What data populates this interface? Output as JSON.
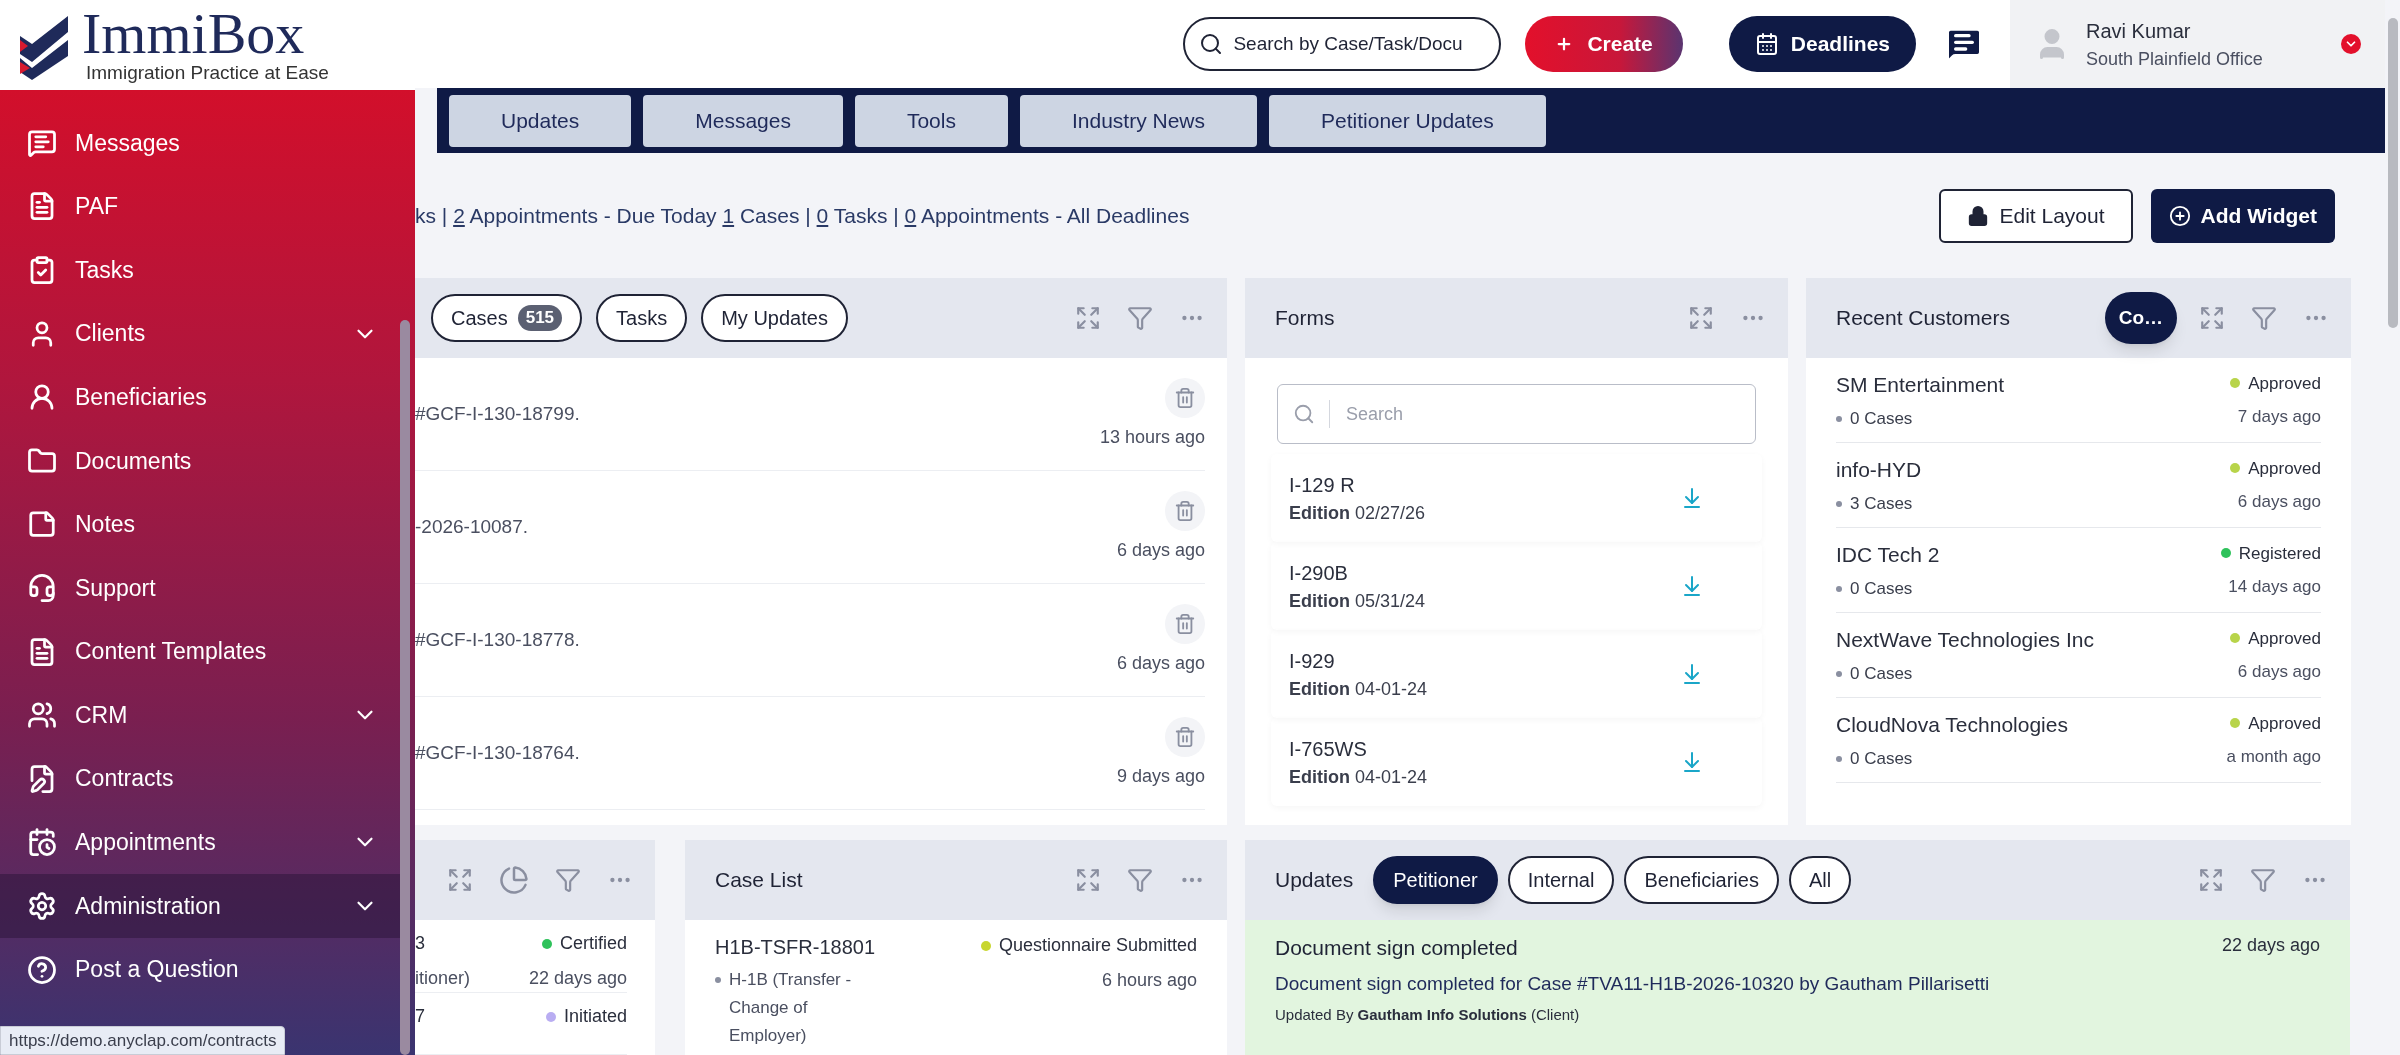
{
  "logo": {
    "name": "ImmiBox",
    "tagline": "Immigration Practice at Ease"
  },
  "sidebar": {
    "items": [
      {
        "label": "Messages",
        "expandable": false,
        "selected": false
      },
      {
        "label": "PAF",
        "expandable": false,
        "selected": false
      },
      {
        "label": "Tasks",
        "expandable": false,
        "selected": false
      },
      {
        "label": "Clients",
        "expandable": true,
        "selected": false
      },
      {
        "label": "Beneficiaries",
        "expandable": false,
        "selected": false
      },
      {
        "label": "Documents",
        "expandable": false,
        "selected": false
      },
      {
        "label": "Notes",
        "expandable": false,
        "selected": false
      },
      {
        "label": "Support",
        "expandable": false,
        "selected": false
      },
      {
        "label": "Content Templates",
        "expandable": false,
        "selected": false
      },
      {
        "label": "CRM",
        "expandable": true,
        "selected": false
      },
      {
        "label": "Contracts",
        "expandable": false,
        "selected": false
      },
      {
        "label": "Appointments",
        "expandable": true,
        "selected": false
      },
      {
        "label": "Administration",
        "expandable": true,
        "selected": true
      },
      {
        "label": "Post a Question",
        "expandable": false,
        "selected": false
      }
    ]
  },
  "status_url": "https://demo.anyclap.com/contracts",
  "header": {
    "search": {
      "placeholder": "Search by Case/Task/Docu"
    },
    "create": "Create",
    "deadlines": "Deadlines",
    "user": {
      "name": "Ravi Kumar",
      "office": "South Plainfield Office"
    }
  },
  "nav_tabs": [
    {
      "label": "Updates",
      "selected": false
    },
    {
      "label": "Messages",
      "selected": false
    },
    {
      "label": "Tools",
      "selected": false
    },
    {
      "label": "Industry News",
      "selected": false
    },
    {
      "label": "Petitioner Updates",
      "selected": false
    }
  ],
  "deadline_summary": [
    {
      "text": "ks | ",
      "link": false
    },
    {
      "text": "2",
      "link": true
    },
    {
      "text": " Appointments - Due Today ",
      "link": false
    },
    {
      "text": "1",
      "link": true
    },
    {
      "text": " Cases | ",
      "link": false
    },
    {
      "text": "0",
      "link": true
    },
    {
      "text": " Tasks | ",
      "link": false
    },
    {
      "text": "0",
      "link": true
    },
    {
      "text": " Appointments - All Deadlines",
      "link": false
    }
  ],
  "buttons": {
    "edit_layout": "Edit Layout",
    "add_widget": "Add Widget"
  },
  "activity_widget": {
    "filters": [
      {
        "label": "Cases",
        "count": "515",
        "selected": false
      },
      {
        "label": "Tasks",
        "selected": false
      },
      {
        "label": "My Updates",
        "selected": false
      }
    ],
    "rows": [
      {
        "text": "#GCF-I-130-18799.",
        "time": "13 hours ago"
      },
      {
        "text": "-2026-10087.",
        "time": "6 days ago"
      },
      {
        "text": "#GCF-I-130-18778.",
        "time": "6 days ago"
      },
      {
        "text": "#GCF-I-130-18764.",
        "time": "9 days ago"
      }
    ]
  },
  "forms_widget": {
    "title": "Forms",
    "search": {
      "placeholder": "Search"
    },
    "forms": [
      {
        "name": "I-129 R",
        "edition_label": "Edition",
        "edition": "02/27/26"
      },
      {
        "name": "I-290B",
        "edition_label": "Edition",
        "edition": "05/31/24"
      },
      {
        "name": "I-929",
        "edition_label": "Edition",
        "edition": "04-01-24"
      },
      {
        "name": "I-765WS",
        "edition_label": "Edition",
        "edition": "04-01-24"
      }
    ]
  },
  "recent_customers": {
    "title": "Recent Customers",
    "toggle": "Co…",
    "customers": [
      {
        "name": "SM Entertainment",
        "cases": "0 Cases",
        "status": "Approved",
        "color": "#b8d44a",
        "time": "7 days ago"
      },
      {
        "name": "info-HYD",
        "cases": "3 Cases",
        "status": "Approved",
        "color": "#b8d44a",
        "time": "6 days ago"
      },
      {
        "name": "IDC Tech 2",
        "cases": "0 Cases",
        "status": "Registered",
        "color": "#2fc25b",
        "time": "14 days ago"
      },
      {
        "name": "NextWave Technologies Inc",
        "cases": "0 Cases",
        "status": "Approved",
        "color": "#b8d44a",
        "time": "6 days ago"
      },
      {
        "name": "CloudNova Technologies",
        "cases": "0 Cases",
        "status": "Approved",
        "color": "#b8d44a",
        "time": "a month ago"
      }
    ]
  },
  "status_widget": {
    "rows": [
      {
        "title": "3",
        "subtitle": "itioner)",
        "status": "Certified",
        "color": "#2fc25b",
        "time": "22 days ago"
      },
      {
        "title": "7",
        "status": "Initiated",
        "color": "#b9adf2"
      }
    ]
  },
  "case_list": {
    "title": "Case List",
    "cases": [
      {
        "id": "H1B-TSFR-18801",
        "type": "H-1B (Transfer - Change of Employer)",
        "status": "Questionnaire Submitted",
        "color": "#c8d62f",
        "time": "6 hours ago"
      }
    ]
  },
  "updates_widget": {
    "title": "Updates",
    "filters": [
      {
        "label": "Petitioner",
        "selected": true
      },
      {
        "label": "Internal",
        "selected": false
      },
      {
        "label": "Beneficiaries",
        "selected": false
      },
      {
        "label": "All",
        "selected": false
      }
    ],
    "items": [
      {
        "title": "Document sign completed",
        "time": "22 days ago",
        "message": "Document sign completed for Case #TVA11-H1B-2026-10320 by Gautham Pillarisetti",
        "updated_by": "Updated By **Gautham Info Solutions** (Client)"
      }
    ]
  }
}
